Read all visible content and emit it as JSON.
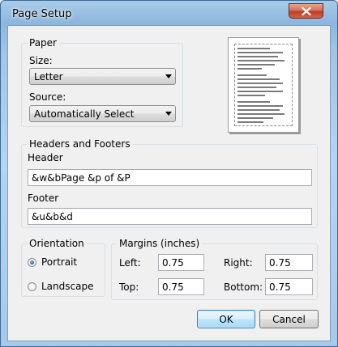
{
  "window": {
    "title": "Page Setup"
  },
  "paper": {
    "group_label": "Paper",
    "size_label": "Size:",
    "size_value": "Letter",
    "source_label": "Source:",
    "source_value": "Automatically Select"
  },
  "headers_footers": {
    "group_label": "Headers and Footers",
    "header_label": "Header",
    "header_value": "&w&bPage &p of &P",
    "footer_label": "Footer",
    "footer_value": "&u&b&d"
  },
  "orientation": {
    "group_label": "Orientation",
    "portrait_label": "Portrait",
    "landscape_label": "Landscape",
    "selected": "portrait"
  },
  "margins": {
    "group_label": "Margins (inches)",
    "left_label": "Left:",
    "left_value": "0.75",
    "right_label": "Right:",
    "right_value": "0.75",
    "top_label": "Top:",
    "top_value": "0.75",
    "bottom_label": "Bottom:",
    "bottom_value": "0.75"
  },
  "buttons": {
    "ok": "OK",
    "cancel": "Cancel"
  },
  "icons": {
    "close": "close-icon",
    "dropdown": "chevron-down-icon"
  }
}
